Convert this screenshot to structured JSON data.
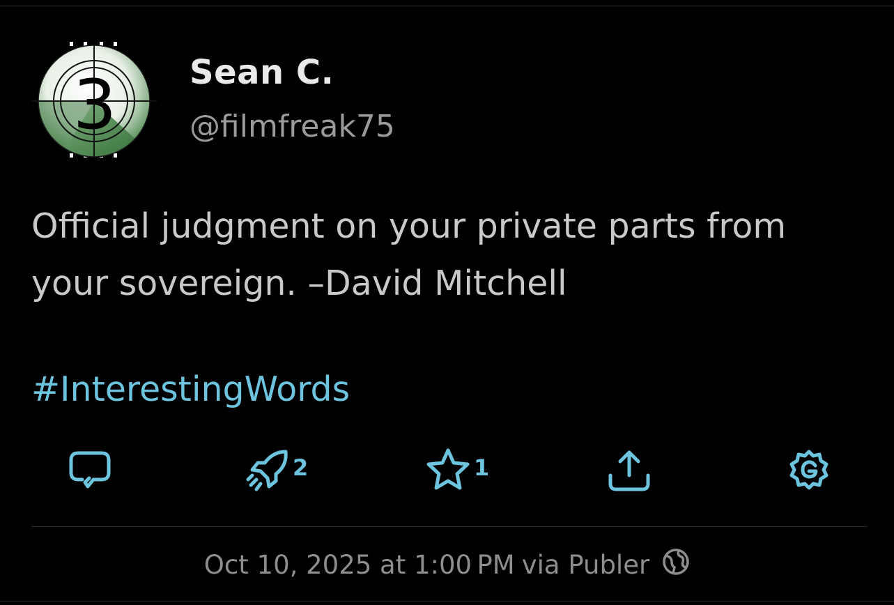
{
  "post": {
    "author": {
      "name": "Sean C.",
      "handle": "@filmfreak75",
      "avatar_icon": "film-countdown-3-icon",
      "avatar_number": "3"
    },
    "text_lines": [
      "Official judgment on your private parts from",
      "your sovereign.  –David Mitchell"
    ],
    "hashtag": "#InterestingWords",
    "actions": {
      "reply": {
        "icon": "reply-icon",
        "count": ""
      },
      "boost": {
        "icon": "rocket-icon",
        "count": "2"
      },
      "favorite": {
        "icon": "star-icon",
        "count": "1"
      },
      "share": {
        "icon": "share-icon",
        "count": ""
      },
      "more": {
        "icon": "gear-icon",
        "count": ""
      }
    },
    "meta": {
      "timestamp": "Oct 10, 2025 at 1:00 PM",
      "via": "via Publer",
      "visibility_icon": "globe-icon"
    }
  },
  "colors": {
    "background": "#000000",
    "accent": "#6dc4de",
    "primary_text": "#e9e9e9",
    "secondary_text": "#9a9a9a",
    "body_text": "#c9c9c9"
  }
}
